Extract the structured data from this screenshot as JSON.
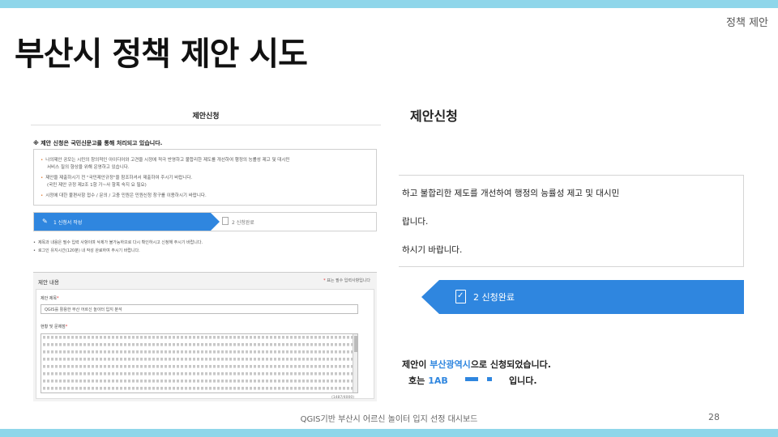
{
  "slide": {
    "section_tag": "정책 제안",
    "title": "부산시 정책 제안 시도",
    "footer": "QGIS기반 부산시 어르신 놀이터 입지 선정 대시보드",
    "page_number": "28"
  },
  "left_screenshot": {
    "heading": "제안신청",
    "notice": "※ 제안 신청은 국민신문고를 통해 처리되고 있습니다.",
    "info_bullets": [
      "나의제안 공모는 시민의 창의적인 아이디어와 고견을 시정에 적극 반영하고 불합리한 제도를 개선하여 행정의 능률성 제고 및 대시민",
      "제안을 제출하시기 전 \"국민제안규정\"을 참조하셔서 제출하여 주시기 바랍니다.",
      "시정에 대한 불편사항 접수 / 문의 / 고충 민원은 민원신청 창구를 이용하시기 바랍니다."
    ],
    "info_sublines": [
      "서비스 질의 향상을 위해 운영하고 있습니다.",
      "(국민 제안 규정 제2조 1항 가~사 항목 숙지 요 필요)"
    ],
    "steps": {
      "active": "1 신청서 작성",
      "next": "2 신청완료"
    },
    "notes": [
      "제목과 내용은 필수 입력 사항이며 삭제가 불가능하므로 다시 확인하시고 신청해 주시기 바랍니다.",
      "로그인 유지시간(120분) 내 작성 완료하여 주시기 바랍니다."
    ],
    "form": {
      "title": "제안 내용",
      "required_note": "표는 필수 입력사항입니다",
      "subject_label": "제안 제목",
      "subject_value": "QGIS를 활용한 부산 어르신 놀이터 입지 분석",
      "body_label": "현황 및 문제점",
      "counter": "(1487/4000)"
    }
  },
  "right_screenshot": {
    "heading": "제안신청",
    "lines": [
      "하고 불합리한 제도를 개선하여 행정의 능률성 제고 및 대시민",
      "랍니다.",
      "하시기 바랍니다."
    ],
    "step_label": "2 신청완료",
    "done_prefix": "제안이 ",
    "done_city": "부산광역시",
    "done_suffix": "으로 신청되었습니다.",
    "number_prefix": "호는",
    "number_code": "1AB",
    "number_suffix": "입니다."
  },
  "colors": {
    "accent_blue": "#2f86df",
    "band": "#8fd6ea"
  },
  "icons": {
    "step_active": "pencil-icon",
    "step_next": "document-check-icon"
  }
}
